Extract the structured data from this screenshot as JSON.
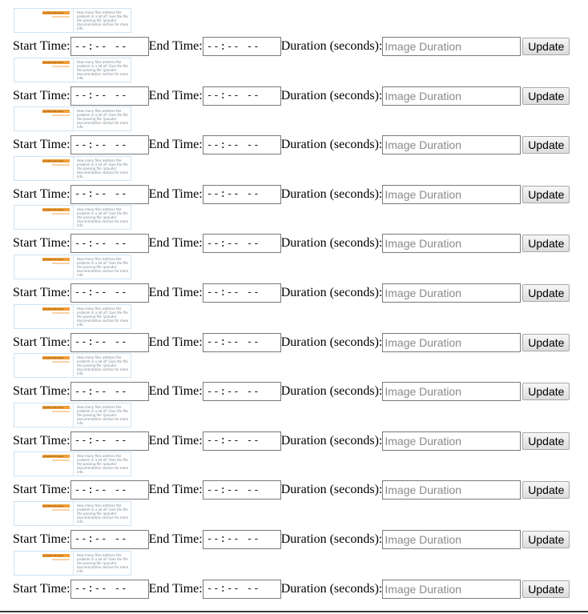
{
  "thumbnail": {
    "title_text": "parallel-bufcauds",
    "body_text": "How many files address the problem in a lot of! Give the file the passing file ‘gcaudio’ documentation section for more info."
  },
  "labels": {
    "start": "Start Time:",
    "end": "End Time:",
    "duration": "Duration (seconds):",
    "update": "Update"
  },
  "placeholders": {
    "time": "--:-- --",
    "duration": "Image Duration"
  },
  "row_count": 12
}
